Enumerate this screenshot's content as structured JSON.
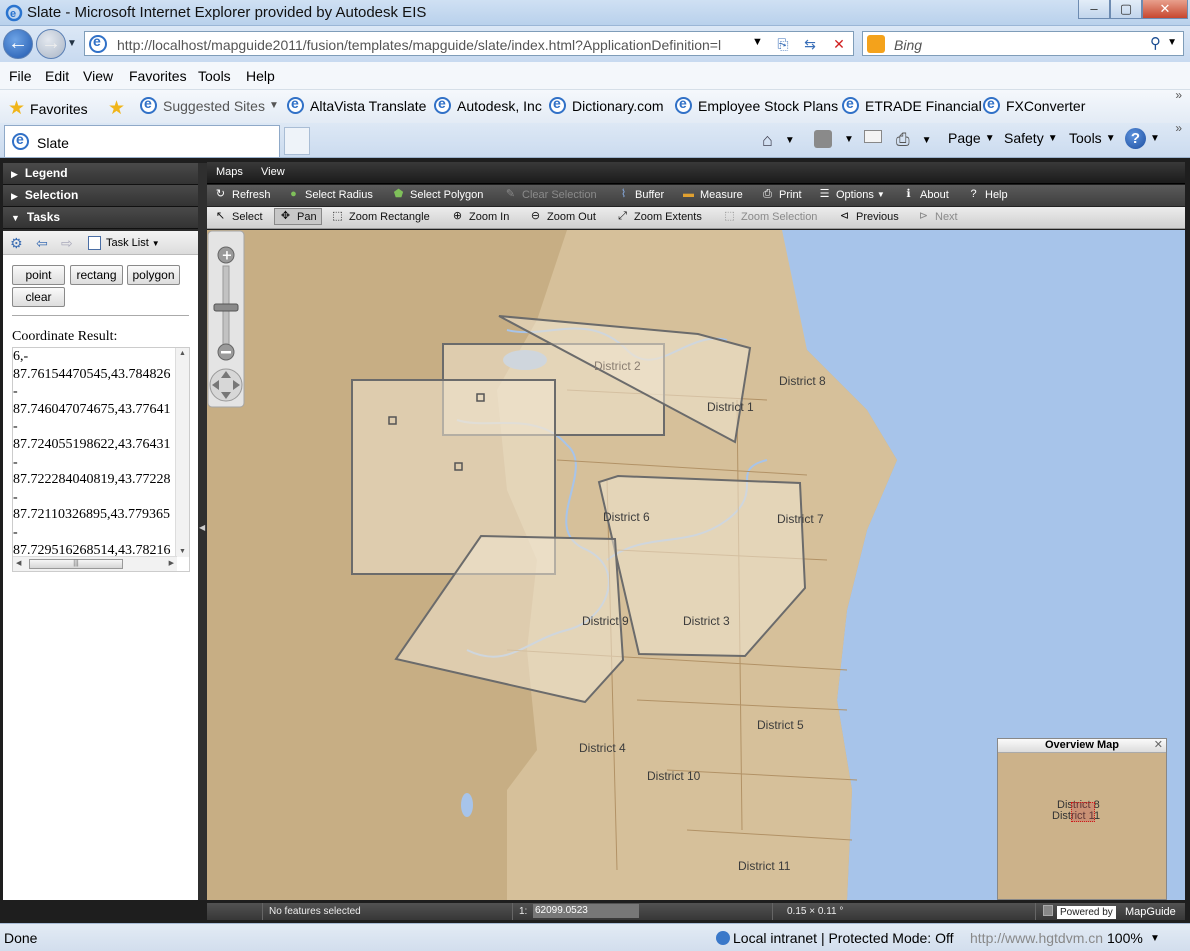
{
  "window": {
    "title": "Slate - Microsoft Internet Explorer provided by Autodesk EIS"
  },
  "address": {
    "url": "http://localhost/mapguide2011/fusion/templates/mapguide/slate/index.html?ApplicationDefinition=l",
    "search_placeholder": "Bing"
  },
  "menu": [
    "File",
    "Edit",
    "View",
    "Favorites",
    "Tools",
    "Help"
  ],
  "favorites": {
    "label": "Favorites",
    "items": [
      "Suggested Sites",
      "AltaVista Translate",
      "Autodesk, Inc",
      "Dictionary.com",
      "Employee Stock Plans",
      "ETRADE Financial",
      "FXConverter"
    ]
  },
  "tab": {
    "title": "Slate"
  },
  "commandbar": {
    "page": "Page",
    "safety": "Safety",
    "tools": "Tools"
  },
  "panel": {
    "legend": "Legend",
    "selection": "Selection",
    "tasks": "Tasks",
    "task_list": "Task List",
    "buttons": [
      "point",
      "rectang",
      "polygon",
      "clear"
    ],
    "coord_label": "Coordinate Result:",
    "coord_text": "6,-\n87.76154470545,43.784826\n-\n87.746047074675,43.77641\n-\n87.724055198622,43.76431\n-\n87.722284040819,43.77228\n-\n87.72110326895,43.779365\n-\n87.729516268514,43.78216"
  },
  "fusion_menu": [
    "Maps",
    "View"
  ],
  "toolbar1": {
    "refresh": "Refresh",
    "select_radius": "Select Radius",
    "select_polygon": "Select Polygon",
    "clear_selection": "Clear Selection",
    "buffer": "Buffer",
    "measure": "Measure",
    "print": "Print",
    "options": "Options",
    "about": "About",
    "help": "Help"
  },
  "toolbar2": {
    "select": "Select",
    "pan": "Pan",
    "zoom_rectangle": "Zoom Rectangle",
    "zoom_in": "Zoom In",
    "zoom_out": "Zoom Out",
    "zoom_extents": "Zoom Extents",
    "zoom_selection": "Zoom Selection",
    "previous": "Previous",
    "next": "Next"
  },
  "map": {
    "districts": [
      "District 2",
      "District 1",
      "District 8",
      "District 6",
      "District 7",
      "District 9",
      "District 3",
      "District 5",
      "District 4",
      "District 10",
      "District 11"
    ],
    "overview_title": "Overview Map",
    "overview_labels": [
      "District 8",
      "District 11"
    ]
  },
  "status": {
    "selection": "No features selected",
    "scale_prefix": "1:",
    "scale": "62099.0523",
    "size": "0.15 × 0.11 °",
    "powered_by": "Powered by",
    "brand": "MapGuide"
  },
  "iestatus": {
    "left": "Done",
    "zone": "Local intranet | Protected Mode: Off",
    "watermark": "http://www.hgtdvm.cn",
    "zoom": "100%"
  },
  "colors": {
    "land": "#c7ae84",
    "water": "#a7c4ea",
    "polygon_stroke": "#6b6b6b"
  }
}
